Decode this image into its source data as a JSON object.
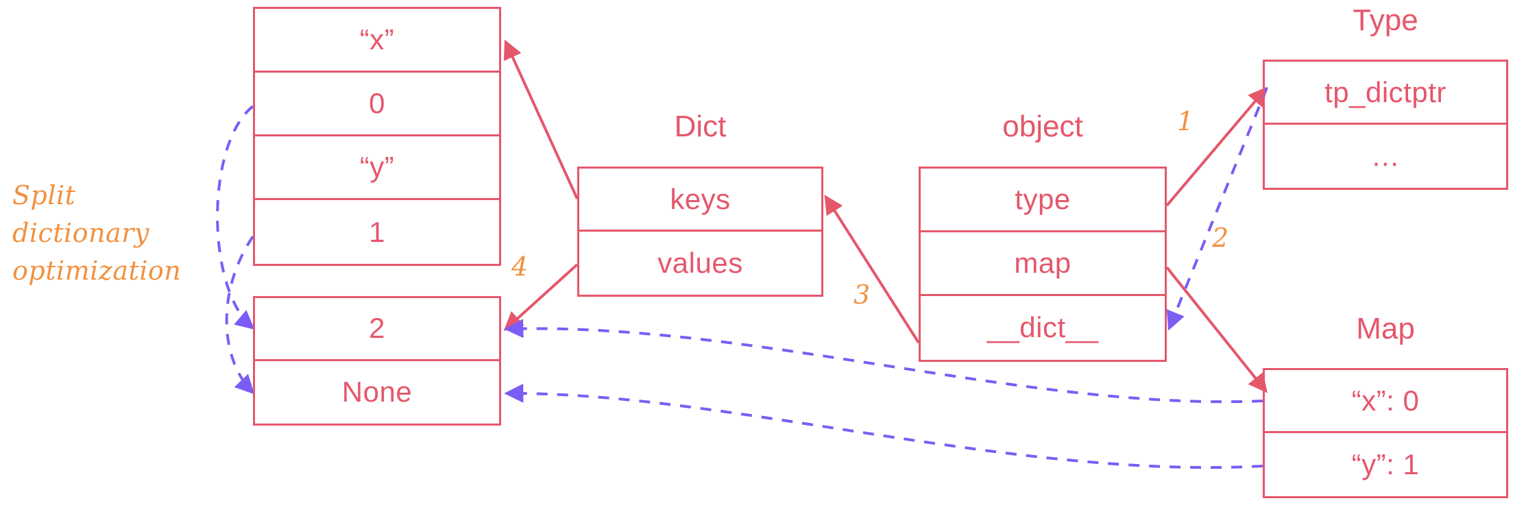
{
  "colors": {
    "structure": "#e5576b",
    "annotation": "#f2913f",
    "pointer_dashed": "#7c5cf5"
  },
  "boxes": {
    "keys_table": {
      "title": "",
      "rows": [
        "“x”",
        "0",
        "“y”",
        "1"
      ]
    },
    "values_table": {
      "title": "",
      "rows": [
        "2",
        "None"
      ]
    },
    "dict": {
      "title": "Dict",
      "rows": [
        "keys",
        "values"
      ]
    },
    "object": {
      "title": "object",
      "rows": [
        "type",
        "map",
        "__dict__"
      ]
    },
    "type": {
      "title": "Type",
      "rows": [
        "tp_dictptr",
        "…"
      ]
    },
    "map": {
      "title": "Map",
      "rows": [
        "“x”: 0",
        "“y”: 1"
      ]
    }
  },
  "annotations": {
    "split_dict": "Split dictionary\noptimization",
    "step_1": "1",
    "step_2": "2",
    "step_3": "3",
    "step_4": "4"
  }
}
